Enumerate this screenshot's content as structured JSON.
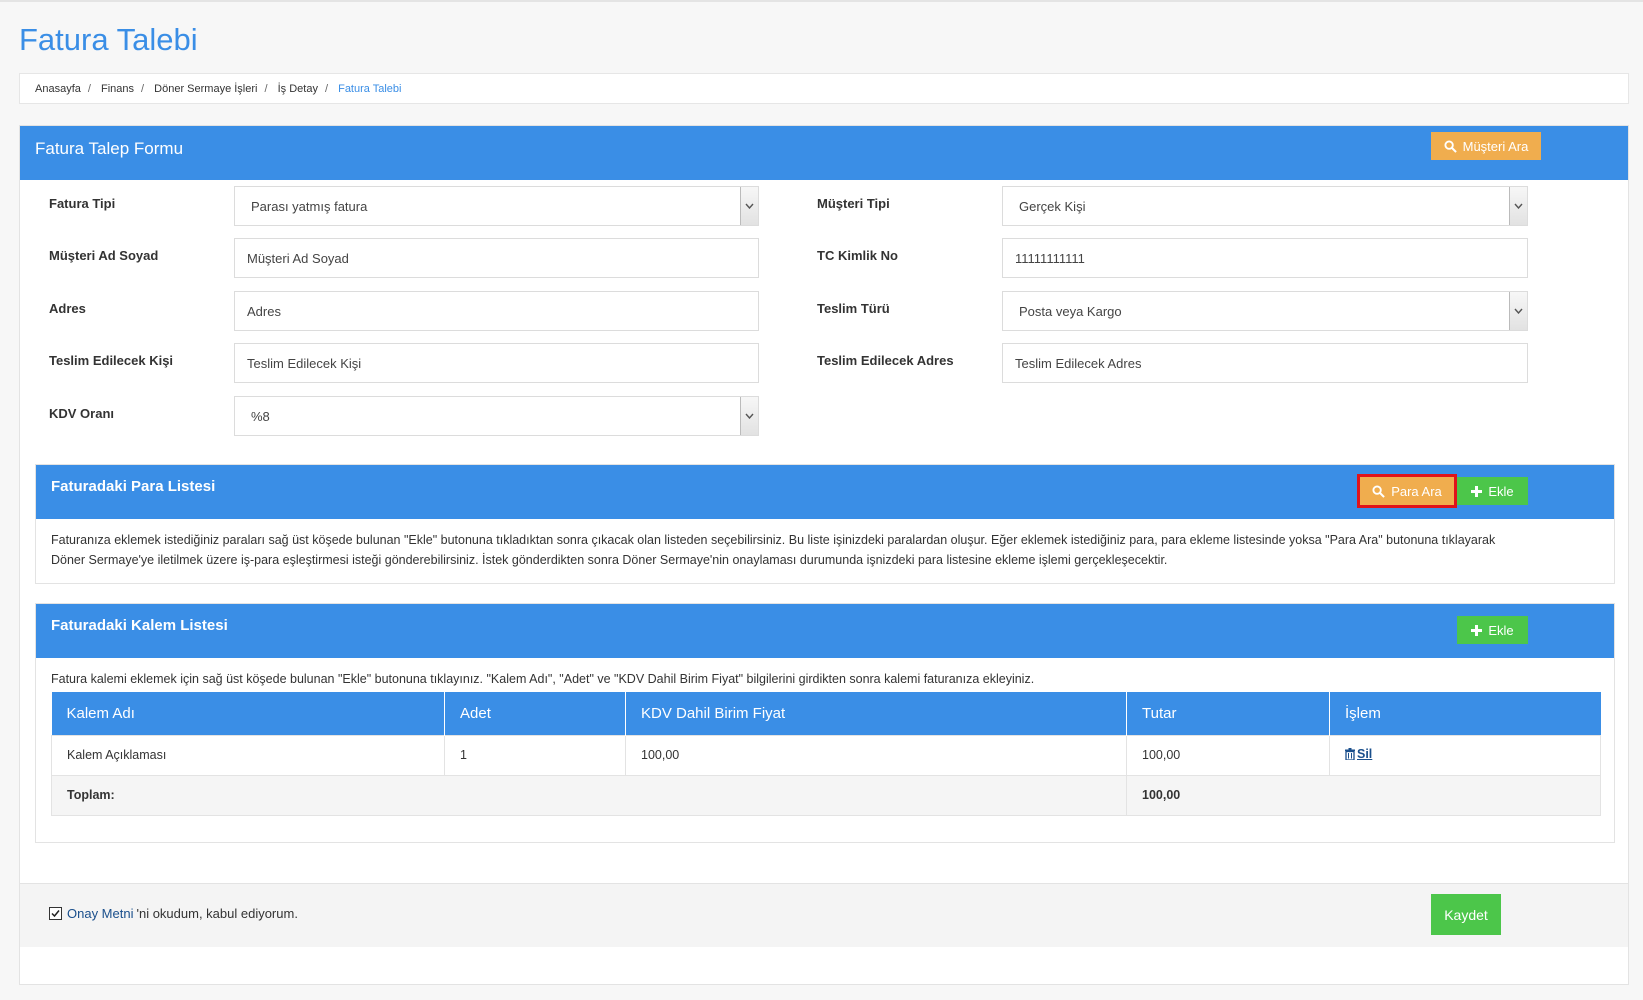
{
  "page": {
    "title": "Fatura Talebi"
  },
  "breadcrumb": [
    "Anasayfa",
    "Finans",
    "Döner Sermaye İşleri",
    "İş Detay",
    "Fatura Talebi"
  ],
  "form_panel": {
    "title": "Fatura Talep Formu",
    "search_customer_label": "Müşteri Ara",
    "fields": {
      "invoice_type": {
        "label": "Fatura Tipi",
        "value": "Parası yatmış fatura"
      },
      "customer_type": {
        "label": "Müşteri Tipi",
        "value": "Gerçek Kişi"
      },
      "customer_name": {
        "label": "Müşteri Ad Soyad",
        "value": "Müşteri Ad Soyad"
      },
      "tc_no": {
        "label": "TC Kimlik No",
        "value": "11111111111"
      },
      "address": {
        "label": "Adres",
        "value": "Adres"
      },
      "delivery_type": {
        "label": "Teslim Türü",
        "value": "Posta veya Kargo"
      },
      "delivery_person": {
        "label": "Teslim Edilecek Kişi",
        "value": "Teslim Edilecek Kişi"
      },
      "delivery_address": {
        "label": "Teslim Edilecek Adres",
        "value": "Teslim Edilecek Adres"
      },
      "vat_rate": {
        "label": "KDV Oranı",
        "value": "%8"
      }
    }
  },
  "money_panel": {
    "title": "Faturadaki Para Listesi",
    "search_label": "Para Ara",
    "add_label": "Ekle",
    "info_line1": "Faturanıza eklemek istediğiniz paraları sağ üst köşede bulunan \"Ekle\" butonuna tıkladıktan sonra çıkacak olan listeden seçebilirsiniz. Bu liste işinizdeki paralardan oluşur. Eğer eklemek istediğiniz para, para ekleme listesinde yoksa \"Para Ara\" butonuna tıklayarak",
    "info_line2": "Döner Sermaye'ye iletilmek üzere iş-para eşleştirmesi isteği gönderebilirsiniz. İstek gönderdikten sonra Döner Sermaye'nin onaylaması durumunda işnizdeki para listesine ekleme işlemi gerçekleşecektir."
  },
  "items_panel": {
    "title": "Faturadaki Kalem Listesi",
    "add_label": "Ekle",
    "info": "Fatura kalemi eklemek için sağ üst köşede bulunan \"Ekle\" butonuna tıklayınız. \"Kalem Adı\", \"Adet\" ve \"KDV Dahil Birim Fiyat\" bilgilerini girdikten sonra kalemi faturanıza ekleyiniz.",
    "columns": [
      "Kalem Adı",
      "Adet",
      "KDV Dahil Birim Fiyat",
      "Tutar",
      "İşlem"
    ],
    "rows": [
      {
        "name": "Kalem Açıklaması",
        "qty": "1",
        "unit_price": "100,00",
        "amount": "100,00",
        "action": "Sil"
      }
    ],
    "total_label": "Toplam:",
    "total_value": "100,00"
  },
  "footer": {
    "consent_link": "Onay Metni",
    "consent_rest": "'ni okudum, kabul ediyorum.",
    "save_label": "Kaydet"
  },
  "colors": {
    "primary": "#3a8ee6",
    "orange": "#f0ad4e",
    "green": "#4cc64a",
    "highlight": "#e0131a"
  }
}
